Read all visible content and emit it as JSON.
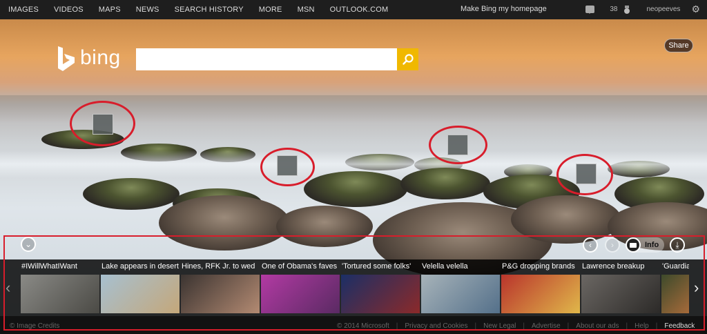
{
  "nav": {
    "items": [
      "IMAGES",
      "VIDEOS",
      "MAPS",
      "NEWS",
      "SEARCH HISTORY",
      "MORE",
      "MSN",
      "OUTLOOK.COM"
    ],
    "homepage_link": "Make Bing my homepage",
    "reward_count": "38",
    "username": "neopeeves"
  },
  "hero": {
    "share_label": "Share",
    "logo_text": "bing",
    "search_value": ""
  },
  "carousel": {
    "info_label": "Info",
    "tiles": [
      {
        "caption": "#IWillWhatIWant",
        "colors": [
          "#8a8a86",
          "#4b4a45"
        ]
      },
      {
        "caption": "Lake appears in desert",
        "colors": [
          "#a7c0d0",
          "#c4a77a"
        ]
      },
      {
        "caption": "Hines, RFK Jr. to wed",
        "colors": [
          "#3b3431",
          "#b38a72"
        ]
      },
      {
        "caption": "One of Obama's faves",
        "colors": [
          "#b23aa3",
          "#5a2a63"
        ]
      },
      {
        "caption": "'Tortured some folks'",
        "colors": [
          "#1b2f66",
          "#8b2a2a"
        ]
      },
      {
        "caption": "Velella velella",
        "colors": [
          "#a7b3b9",
          "#54708a"
        ]
      },
      {
        "caption": "P&G dropping brands",
        "colors": [
          "#b9342c",
          "#e0b74a"
        ]
      },
      {
        "caption": "Lawrence breakup",
        "colors": [
          "#6b6763",
          "#2c2a28"
        ]
      },
      {
        "caption": "'Guardians",
        "colors": [
          "#3d4a2b",
          "#a66a3a"
        ]
      }
    ]
  },
  "footer": {
    "credits": "© Image Credits",
    "links": [
      "© 2014 Microsoft",
      "Privacy and Cookies",
      "New Legal",
      "Advertise",
      "About our ads",
      "Help"
    ],
    "feedback": "Feedback"
  },
  "colors": {
    "annotation_red": "#d81d2b",
    "search_button": "#f0b800"
  }
}
